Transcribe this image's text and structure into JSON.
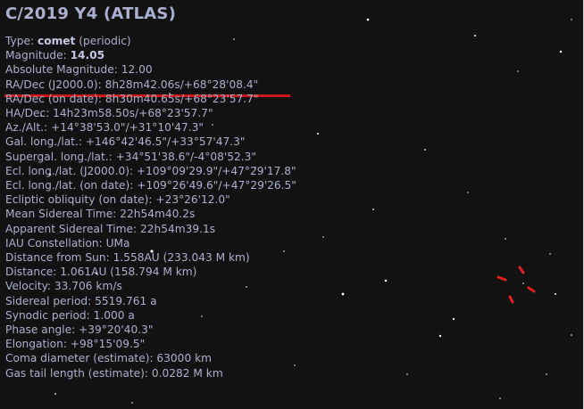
{
  "object": {
    "title": "C/2019 Y4 (ATLAS)",
    "type_label": "Type:",
    "type_value": "comet",
    "type_suffix": "(periodic)",
    "magnitude_label": "Magnitude:",
    "magnitude_value": "14.05"
  },
  "details": [
    "Absolute Magnitude: 12.00",
    "RA/Dec (J2000.0): 8h28m42.06s/+68°28'08.4\"",
    "RA/Dec (on date): 8h30m40.65s/+68°23'57.7\"",
    "HA/Dec: 14h23m58.50s/+68°23'57.7\"",
    "Az./Alt.: +14°38'53.0\"/+31°10'47.3\"",
    "Gal. long./lat.: +146°42'46.5\"/+33°57'47.3\"",
    "Supergal. long./lat.: +34°51'38.6\"/-4°08'52.3\"",
    "Ecl. long./lat. (J2000.0): +109°09'29.9\"/+47°29'17.8\"",
    "Ecl. long./lat. (on date): +109°26'49.6\"/+47°29'26.5\"",
    "Ecliptic obliquity (on date): +23°26'12.0\"",
    "Mean Sidereal Time: 22h54m40.2s",
    "Apparent Sidereal Time: 22h54m39.1s",
    "IAU Constellation: UMa",
    "Distance from Sun: 1.558AU (233.043 M km)",
    "Distance: 1.061AU (158.794 M km)",
    "Velocity: 33.706 km/s",
    "Sidereal period: 5519.761 a",
    "Synodic period: 1.000 a",
    "Phase angle: +39°20'40.3\"",
    "Elongation: +98°15'09.5\"",
    "Coma diameter (estimate): 63000 km",
    "Gas tail length (estimate): 0.0282 M km"
  ],
  "colors": {
    "background": "#121212",
    "info_text": "#aab0cf",
    "highlight_underline": "#cc1818",
    "selection_marker": "#e02020"
  },
  "icons": {
    "selection_marker": "target-reticle-icon"
  }
}
